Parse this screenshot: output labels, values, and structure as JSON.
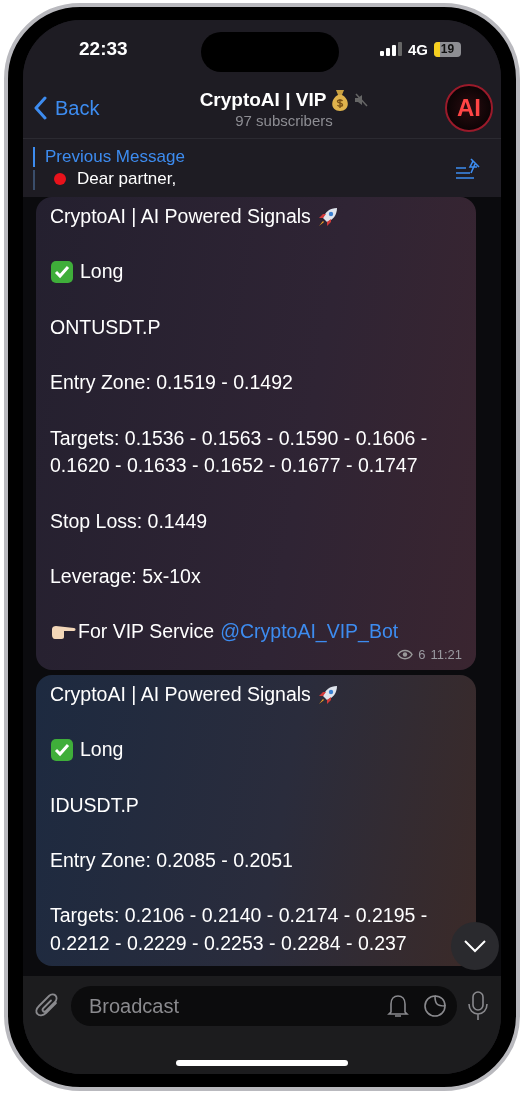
{
  "status_bar": {
    "time": "22:33",
    "network": "4G",
    "battery": "19"
  },
  "header": {
    "back": "Back",
    "title": "CryptoAI | VIP",
    "subtitle": "97 subscribers",
    "muted": true,
    "avatar": "AI"
  },
  "pinned": {
    "label": "Previous Message",
    "text": "Dear partner,"
  },
  "messages": [
    {
      "title": "CryptoAI | AI Powered Signals",
      "direction": "Long",
      "pair": "ONTUSDT.P",
      "entry": "Entry Zone: 0.1519 - 0.1492",
      "targets": "Targets: 0.1536 - 0.1563 - 0.1590 - 0.1606 - 0.1620 - 0.1633 - 0.1652 - 0.1677 - 0.1747",
      "stop_loss": "Stop Loss: 0.1449",
      "leverage": "Leverage: 5x-10x",
      "promo": "For VIP Service",
      "link": "@CryptoAI_VIP_Bot",
      "views": "6",
      "time": "11:21"
    },
    {
      "title": "CryptoAI | AI Powered Signals",
      "direction": "Long",
      "pair": "IDUSDT.P",
      "entry": "Entry Zone: 0.2085 - 0.2051",
      "targets": "Targets: 0.2106 - 0.2140 - 0.2174 - 0.2195 - 0.2212 - 0.2229 - 0.2253 - 0.2284 - 0.237"
    }
  ],
  "composer": {
    "placeholder": "Broadcast"
  }
}
